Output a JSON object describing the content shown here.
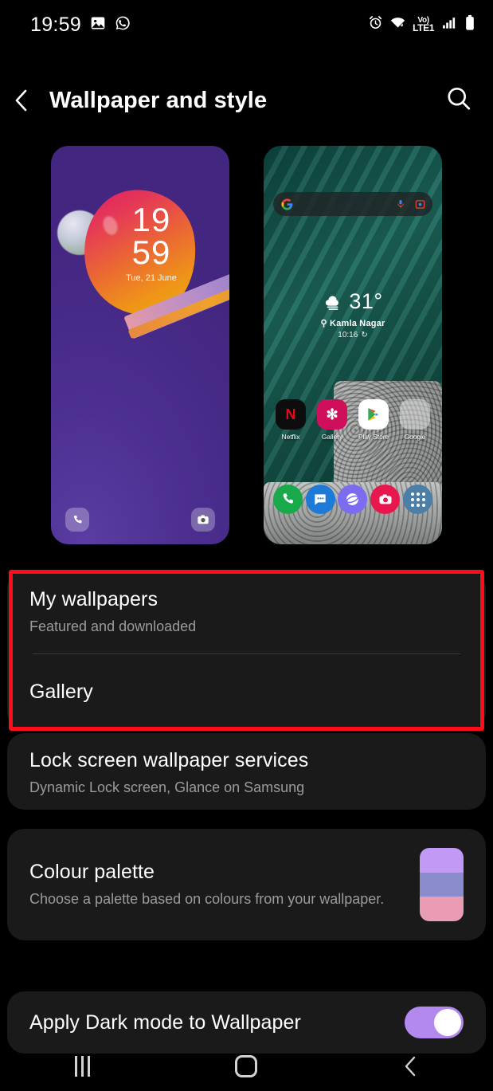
{
  "statusbar": {
    "time": "19:59",
    "left_icons": [
      "image-icon",
      "whatsapp-icon"
    ],
    "right_icons": [
      "alarm-icon",
      "wifi-icon",
      "signal-icon",
      "battery-icon"
    ],
    "network_label_top": "Vo)",
    "network_label_bottom": "LTE1"
  },
  "header": {
    "title": "Wallpaper and style",
    "back_icon": "chevron-left-icon",
    "search_icon": "search-icon"
  },
  "previews": {
    "lock": {
      "hours": "19",
      "minutes": "59",
      "date": "Tue, 21 June",
      "shortcut_left": "phone-icon",
      "shortcut_right": "camera-icon"
    },
    "home": {
      "search_placeholder": "",
      "google_icon": "google-g-icon",
      "mic_icon": "microphone-icon",
      "lens_icon": "google-lens-icon",
      "weather": {
        "temperature": "31°",
        "location": "Kamla Nagar",
        "time": "10:16",
        "condition_icon": "cloudy-icon",
        "location_icon": "pin-icon",
        "refresh_icon": "refresh-icon"
      },
      "apps": [
        {
          "label": "Netflix",
          "glyph": "N",
          "bg": "#0d0d0d",
          "fg": "#e50914"
        },
        {
          "label": "Gallery",
          "glyph": "✻",
          "bg": "#cf0f5c",
          "fg": "#ffffff"
        },
        {
          "label": "Play Store",
          "glyph": "▶",
          "bg": "#ffffff",
          "fg": "#34a853"
        },
        {
          "label": "Google",
          "glyph": "",
          "bg": "rgba(240,240,240,.45)",
          "fg": "#ffffff"
        }
      ],
      "dock": [
        {
          "name": "phone-icon",
          "glyph": "✆",
          "bg": "#18a94b"
        },
        {
          "name": "messages-icon",
          "glyph": "💬",
          "bg": "#1d7ad6"
        },
        {
          "name": "internet-icon",
          "glyph": "◯",
          "bg": "#7b6cf0"
        },
        {
          "name": "camera-icon",
          "glyph": "◉",
          "bg": "#e8174e"
        },
        {
          "name": "apps-icon",
          "glyph": "⠿",
          "bg": "#4b7fa6"
        }
      ]
    }
  },
  "settings": {
    "my_wallpapers": {
      "title": "My wallpapers",
      "subtitle": "Featured and downloaded"
    },
    "gallery": {
      "title": "Gallery"
    },
    "lock_screen_services": {
      "title": "Lock screen wallpaper services",
      "subtitle": "Dynamic Lock screen, Glance on Samsung"
    },
    "colour_palette": {
      "title": "Colour palette",
      "subtitle": "Choose a palette based on colours from your wallpaper.",
      "swatch_colors": [
        "#c09af5",
        "#8a8ccc",
        "#eb9cb5"
      ]
    },
    "dark_mode": {
      "title": "Apply Dark mode to Wallpaper",
      "toggle_state": "on",
      "toggle_color": "#b389f0"
    }
  },
  "highlight": {
    "color": "#fb0d1b"
  },
  "navbar": {
    "recents_icon": "recents-icon",
    "home_icon": "home-icon",
    "back_icon": "back-icon"
  }
}
